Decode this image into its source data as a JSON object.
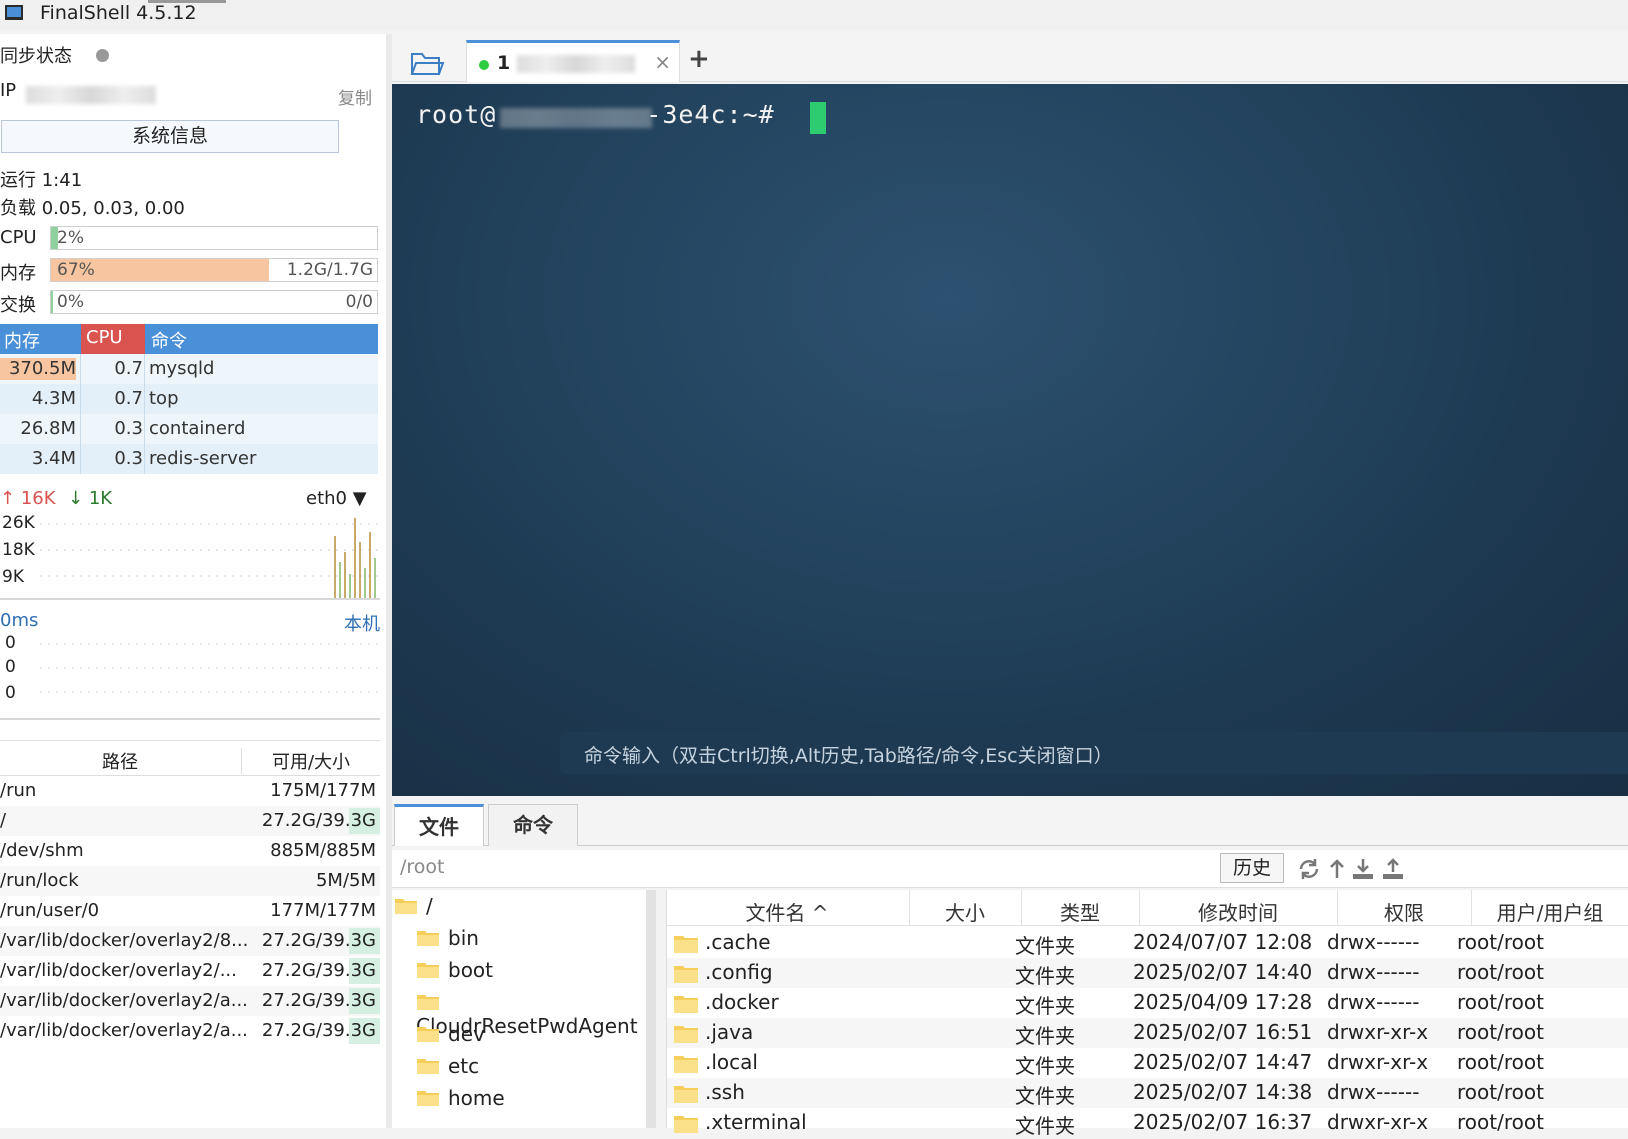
{
  "window": {
    "title": "FinalShell 4.5.12"
  },
  "sidebar": {
    "sync_label": "同步状态",
    "ip_label": "IP",
    "copy_label": "复制",
    "sysinfo_button": "系统信息",
    "uptime": "运行 1:41",
    "load": "负载 0.05, 0.03, 0.00",
    "meters": [
      {
        "label": "CPU",
        "percent_text": "2%",
        "amount": "",
        "fraction": 0.02,
        "color": "#8fd19e"
      },
      {
        "label": "内存",
        "percent_text": "67%",
        "amount": "1.2G/1.7G",
        "fraction": 0.67,
        "color": "#f7c59f"
      },
      {
        "label": "交换",
        "percent_text": "0%",
        "amount": "0/0",
        "fraction": 0.0,
        "color": "#8fd19e"
      }
    ],
    "process_headers": [
      "内存",
      "CPU",
      "命令"
    ],
    "processes": [
      {
        "mem": "370.5M",
        "cpu": "0.7",
        "cmd": "mysqld",
        "mem_fraction": 0.2
      },
      {
        "mem": "4.3M",
        "cpu": "0.7",
        "cmd": "top",
        "mem_fraction": 0
      },
      {
        "mem": "26.8M",
        "cpu": "0.3",
        "cmd": "containerd",
        "mem_fraction": 0
      },
      {
        "mem": "3.4M",
        "cpu": "0.3",
        "cmd": "redis-server",
        "mem_fraction": 0
      }
    ],
    "network": {
      "up": "16K",
      "down": "1K",
      "iface": "eth0",
      "y_ticks": [
        "26K",
        "18K",
        "9K"
      ]
    },
    "ping": {
      "latency": "0ms",
      "target": "本机",
      "y_ticks": [
        "0",
        "0",
        "0"
      ]
    },
    "disks": {
      "headers": [
        "路径",
        "可用/大小"
      ],
      "rows": [
        {
          "path": "/run",
          "size": "175M/177M",
          "used_fraction": 0.0
        },
        {
          "path": "/",
          "size": "27.2G/39.3G",
          "used_fraction": 0.31
        },
        {
          "path": "/dev/shm",
          "size": "885M/885M",
          "used_fraction": 0.0
        },
        {
          "path": "/run/lock",
          "size": "5M/5M",
          "used_fraction": 0.0
        },
        {
          "path": "/run/user/0",
          "size": "177M/177M",
          "used_fraction": 0.0
        },
        {
          "path": "/var/lib/docker/overlay2/8...",
          "size": "27.2G/39.3G",
          "used_fraction": 0.31
        },
        {
          "path": "/var/lib/docker/overlay2/...",
          "size": "27.2G/39.3G",
          "used_fraction": 0.31
        },
        {
          "path": "/var/lib/docker/overlay2/a...",
          "size": "27.2G/39.3G",
          "used_fraction": 0.31
        },
        {
          "path": "/var/lib/docker/overlay2/a...",
          "size": "27.2G/39.3G",
          "used_fraction": 0.31
        }
      ]
    }
  },
  "tabs": {
    "session_number": "1",
    "close_glyph": "×",
    "add_glyph": "+"
  },
  "terminal": {
    "prompt_prefix": "root@",
    "prompt_suffix": "-3e4c:~#",
    "command_hint": "命令输入（双击Ctrl切换,Alt历史,Tab路径/命令,Esc关闭窗口）"
  },
  "bottom": {
    "tabs": [
      "文件",
      "命令"
    ],
    "path": "/root",
    "history_button": "历史",
    "tree": [
      "/",
      "bin",
      "boot",
      "CloudrResetPwdAgent",
      "dev",
      "etc",
      "home"
    ],
    "file_headers": [
      "文件名 ^",
      "大小",
      "类型",
      "修改时间",
      "权限",
      "用户/用户组"
    ],
    "files": [
      {
        "name": ".cache",
        "size": "",
        "type": "文件夹",
        "mtime": "2024/07/07 12:08",
        "perm": "drwx------",
        "owner": "root/root"
      },
      {
        "name": ".config",
        "size": "",
        "type": "文件夹",
        "mtime": "2025/02/07 14:40",
        "perm": "drwx------",
        "owner": "root/root"
      },
      {
        "name": ".docker",
        "size": "",
        "type": "文件夹",
        "mtime": "2025/04/09 17:28",
        "perm": "drwx------",
        "owner": "root/root"
      },
      {
        "name": ".java",
        "size": "",
        "type": "文件夹",
        "mtime": "2025/02/07 16:51",
        "perm": "drwxr-xr-x",
        "owner": "root/root"
      },
      {
        "name": ".local",
        "size": "",
        "type": "文件夹",
        "mtime": "2025/02/07 14:47",
        "perm": "drwxr-xr-x",
        "owner": "root/root"
      },
      {
        "name": ".ssh",
        "size": "",
        "type": "文件夹",
        "mtime": "2025/02/07 14:38",
        "perm": "drwx------",
        "owner": "root/root"
      },
      {
        "name": ".xterminal",
        "size": "",
        "type": "文件夹",
        "mtime": "2025/02/07 16:37",
        "perm": "drwxr-xr-x",
        "owner": "root/root"
      }
    ]
  },
  "colors": {
    "accent": "#4a90d9",
    "terminal_bg": "#1f3d57",
    "cursor": "#2ecc71",
    "cpu_header": "#d9534f"
  }
}
